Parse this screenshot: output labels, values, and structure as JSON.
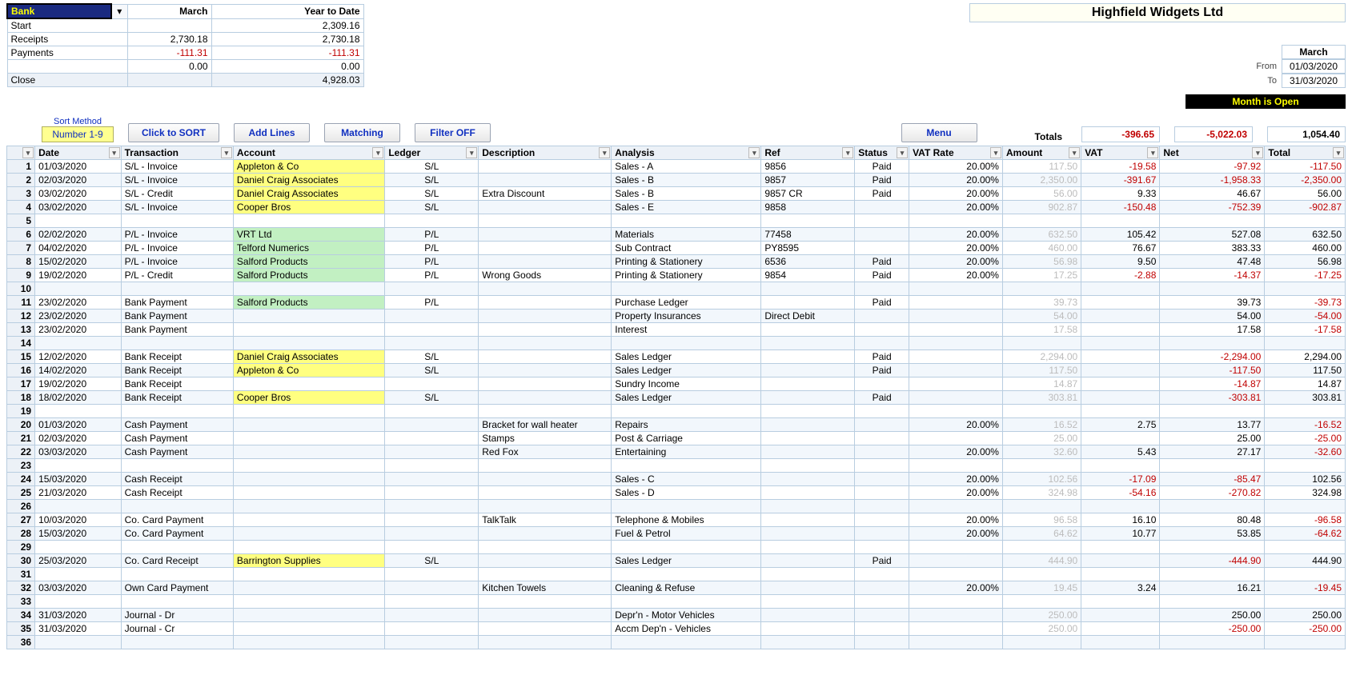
{
  "summary": {
    "bank_label": "Bank",
    "month_hdr": "March",
    "ytd_hdr": "Year to Date",
    "rows": {
      "start": {
        "label": "Start",
        "month": "",
        "ytd": "2,309.16"
      },
      "receipts": {
        "label": "Receipts",
        "month": "2,730.18",
        "ytd": "2,730.18"
      },
      "payments": {
        "label": "Payments",
        "month": "-111.31",
        "ytd": "-111.31"
      },
      "zero": {
        "label": "",
        "month": "0.00",
        "ytd": "0.00"
      },
      "close": {
        "label": "Close",
        "month": "",
        "ytd": "4,928.03"
      }
    }
  },
  "company": "Highfield Widgets Ltd",
  "period": {
    "month": "March",
    "from_label": "From",
    "from": "01/03/2020",
    "to_label": "To",
    "to": "31/03/2020",
    "status": "Month  is  Open"
  },
  "sort": {
    "title": "Sort Method",
    "badge": "Number  1-9"
  },
  "buttons": {
    "sort": "Click to SORT",
    "add_lines": "Add Lines",
    "matching": "Matching",
    "filter_off": "Filter OFF",
    "menu": "Menu"
  },
  "totals": {
    "label": "Totals",
    "amount": "-396.65",
    "vat": "-5,022.03",
    "net": "1,054.40"
  },
  "columns": {
    "date": "Date",
    "transaction": "Transaction",
    "account": "Account",
    "ledger": "Ledger",
    "description": "Description",
    "analysis": "Analysis",
    "ref": "Ref",
    "status": "Status",
    "vat_rate": "VAT Rate",
    "amount": "Amount",
    "vat": "VAT",
    "net": "Net",
    "total": "Total"
  },
  "rows": [
    {
      "n": "1",
      "date": "01/03/2020",
      "trans": "S/L - Invoice",
      "account": "Appleton & Co",
      "acct_cls": "acct-yellow",
      "ledger": "S/L",
      "desc": "",
      "analysis": "Sales - A",
      "ref": "9856",
      "status": "Paid",
      "vatrate": "20.00%",
      "amount": "117.50",
      "vat": "-19.58",
      "net": "-97.92",
      "total": "-117.50",
      "vat_red": true,
      "net_red": true,
      "total_red": true
    },
    {
      "n": "2",
      "date": "02/03/2020",
      "trans": "S/L - Invoice",
      "account": "Daniel Craig Associates",
      "acct_cls": "acct-yellow",
      "ledger": "S/L",
      "desc": "",
      "analysis": "Sales - B",
      "ref": "9857",
      "status": "Paid",
      "vatrate": "20.00%",
      "amount": "2,350.00",
      "vat": "-391.67",
      "net": "-1,958.33",
      "total": "-2,350.00",
      "vat_red": true,
      "net_red": true,
      "total_red": true
    },
    {
      "n": "3",
      "date": "03/02/2020",
      "trans": "S/L - Credit",
      "account": "Daniel Craig Associates",
      "acct_cls": "acct-yellow",
      "ledger": "S/L",
      "desc": "Extra Discount",
      "analysis": "Sales - B",
      "ref": "9857 CR",
      "status": "Paid",
      "vatrate": "20.00%",
      "amount": "56.00",
      "vat": "9.33",
      "net": "46.67",
      "total": "56.00"
    },
    {
      "n": "4",
      "date": "03/02/2020",
      "trans": "S/L - Invoice",
      "account": "Cooper Bros",
      "acct_cls": "acct-yellow",
      "ledger": "S/L",
      "desc": "",
      "analysis": "Sales - E",
      "ref": "9858",
      "status": "",
      "vatrate": "20.00%",
      "amount": "902.87",
      "vat": "-150.48",
      "net": "-752.39",
      "total": "-902.87",
      "vat_red": true,
      "net_red": true,
      "total_red": true
    },
    {
      "n": "5"
    },
    {
      "n": "6",
      "date": "02/02/2020",
      "trans": "P/L - Invoice",
      "account": "VRT Ltd",
      "acct_cls": "acct-green",
      "ledger": "P/L",
      "desc": "",
      "analysis": "Materials",
      "ref": "77458",
      "status": "",
      "vatrate": "20.00%",
      "amount": "632.50",
      "vat": "105.42",
      "net": "527.08",
      "total": "632.50"
    },
    {
      "n": "7",
      "date": "04/02/2020",
      "trans": "P/L - Invoice",
      "account": "Telford Numerics",
      "acct_cls": "acct-green",
      "ledger": "P/L",
      "desc": "",
      "analysis": "Sub Contract",
      "ref": "PY8595",
      "status": "",
      "vatrate": "20.00%",
      "amount": "460.00",
      "vat": "76.67",
      "net": "383.33",
      "total": "460.00"
    },
    {
      "n": "8",
      "date": "15/02/2020",
      "trans": "P/L - Invoice",
      "account": "Salford Products",
      "acct_cls": "acct-green",
      "ledger": "P/L",
      "desc": "",
      "analysis": "Printing & Stationery",
      "ref": "6536",
      "status": "Paid",
      "vatrate": "20.00%",
      "amount": "56.98",
      "vat": "9.50",
      "net": "47.48",
      "total": "56.98"
    },
    {
      "n": "9",
      "date": "19/02/2020",
      "trans": "P/L - Credit",
      "account": "Salford Products",
      "acct_cls": "acct-green",
      "ledger": "P/L",
      "desc": "Wrong Goods",
      "analysis": "Printing & Stationery",
      "ref": "9854",
      "status": "Paid",
      "vatrate": "20.00%",
      "amount": "17.25",
      "vat": "-2.88",
      "net": "-14.37",
      "total": "-17.25",
      "vat_red": true,
      "net_red": true,
      "total_red": true
    },
    {
      "n": "10"
    },
    {
      "n": "11",
      "date": "23/02/2020",
      "trans": "Bank Payment",
      "account": "Salford Products",
      "acct_cls": "acct-green",
      "ledger": "P/L",
      "desc": "",
      "analysis": "Purchase Ledger",
      "ref": "",
      "status": "Paid",
      "vatrate": "",
      "amount": "39.73",
      "vat": "",
      "net": "39.73",
      "total": "-39.73",
      "total_red": true
    },
    {
      "n": "12",
      "date": "23/02/2020",
      "trans": "Bank Payment",
      "account": "",
      "ledger": "",
      "desc": "",
      "analysis": "Property Insurances",
      "ref": "Direct Debit",
      "status": "",
      "vatrate": "",
      "amount": "54.00",
      "vat": "",
      "net": "54.00",
      "total": "-54.00",
      "total_red": true
    },
    {
      "n": "13",
      "date": "23/02/2020",
      "trans": "Bank Payment",
      "account": "",
      "ledger": "",
      "desc": "",
      "analysis": "Interest",
      "ref": "",
      "status": "",
      "vatrate": "",
      "amount": "17.58",
      "vat": "",
      "net": "17.58",
      "total": "-17.58",
      "total_red": true
    },
    {
      "n": "14"
    },
    {
      "n": "15",
      "date": "12/02/2020",
      "trans": "Bank Receipt",
      "account": "Daniel Craig Associates",
      "acct_cls": "acct-yellow",
      "ledger": "S/L",
      "desc": "",
      "analysis": "Sales Ledger",
      "ref": "",
      "status": "Paid",
      "vatrate": "",
      "amount": "2,294.00",
      "vat": "",
      "net": "-2,294.00",
      "total": "2,294.00",
      "net_red": true
    },
    {
      "n": "16",
      "date": "14/02/2020",
      "trans": "Bank Receipt",
      "account": "Appleton & Co",
      "acct_cls": "acct-yellow",
      "ledger": "S/L",
      "desc": "",
      "analysis": "Sales Ledger",
      "ref": "",
      "status": "Paid",
      "vatrate": "",
      "amount": "117.50",
      "vat": "",
      "net": "-117.50",
      "total": "117.50",
      "net_red": true
    },
    {
      "n": "17",
      "date": "19/02/2020",
      "trans": "Bank Receipt",
      "account": "",
      "ledger": "",
      "desc": "",
      "analysis": "Sundry Income",
      "ref": "",
      "status": "",
      "vatrate": "",
      "amount": "14.87",
      "vat": "",
      "net": "-14.87",
      "total": "14.87",
      "net_red": true
    },
    {
      "n": "18",
      "date": "18/02/2020",
      "trans": "Bank Receipt",
      "account": "Cooper Bros",
      "acct_cls": "acct-yellow",
      "ledger": "S/L",
      "desc": "",
      "analysis": "Sales Ledger",
      "ref": "",
      "status": "Paid",
      "vatrate": "",
      "amount": "303.81",
      "vat": "",
      "net": "-303.81",
      "total": "303.81",
      "net_red": true
    },
    {
      "n": "19"
    },
    {
      "n": "20",
      "date": "01/03/2020",
      "trans": "Cash Payment",
      "account": "",
      "ledger": "",
      "desc": "Bracket for wall heater",
      "analysis": "Repairs",
      "ref": "",
      "status": "",
      "vatrate": "20.00%",
      "amount": "16.52",
      "vat": "2.75",
      "net": "13.77",
      "total": "-16.52",
      "total_red": true
    },
    {
      "n": "21",
      "date": "02/03/2020",
      "trans": "Cash Payment",
      "account": "",
      "ledger": "",
      "desc": "Stamps",
      "analysis": "Post & Carriage",
      "ref": "",
      "status": "",
      "vatrate": "",
      "amount": "25.00",
      "vat": "",
      "net": "25.00",
      "total": "-25.00",
      "total_red": true
    },
    {
      "n": "22",
      "date": "03/03/2020",
      "trans": "Cash Payment",
      "account": "",
      "ledger": "",
      "desc": "Red Fox",
      "analysis": "Entertaining",
      "ref": "",
      "status": "",
      "vatrate": "20.00%",
      "amount": "32.60",
      "vat": "5.43",
      "net": "27.17",
      "total": "-32.60",
      "total_red": true
    },
    {
      "n": "23"
    },
    {
      "n": "24",
      "date": "15/03/2020",
      "trans": "Cash Receipt",
      "account": "",
      "ledger": "",
      "desc": "",
      "analysis": "Sales - C",
      "ref": "",
      "status": "",
      "vatrate": "20.00%",
      "amount": "102.56",
      "vat": "-17.09",
      "net": "-85.47",
      "total": "102.56",
      "vat_red": true,
      "net_red": true
    },
    {
      "n": "25",
      "date": "21/03/2020",
      "trans": "Cash Receipt",
      "account": "",
      "ledger": "",
      "desc": "",
      "analysis": "Sales - D",
      "ref": "",
      "status": "",
      "vatrate": "20.00%",
      "amount": "324.98",
      "vat": "-54.16",
      "net": "-270.82",
      "total": "324.98",
      "vat_red": true,
      "net_red": true
    },
    {
      "n": "26"
    },
    {
      "n": "27",
      "date": "10/03/2020",
      "trans": "Co. Card Payment",
      "account": "",
      "ledger": "",
      "desc": "TalkTalk",
      "analysis": "Telephone & Mobiles",
      "ref": "",
      "status": "",
      "vatrate": "20.00%",
      "amount": "96.58",
      "vat": "16.10",
      "net": "80.48",
      "total": "-96.58",
      "total_red": true
    },
    {
      "n": "28",
      "date": "15/03/2020",
      "trans": "Co. Card Payment",
      "account": "",
      "ledger": "",
      "desc": "",
      "analysis": "Fuel & Petrol",
      "ref": "",
      "status": "",
      "vatrate": "20.00%",
      "amount": "64.62",
      "vat": "10.77",
      "net": "53.85",
      "total": "-64.62",
      "total_red": true
    },
    {
      "n": "29"
    },
    {
      "n": "30",
      "date": "25/03/2020",
      "trans": "Co. Card Receipt",
      "account": "Barrington Supplies",
      "acct_cls": "acct-yellow",
      "ledger": "S/L",
      "desc": "",
      "analysis": "Sales Ledger",
      "ref": "",
      "status": "Paid",
      "vatrate": "",
      "amount": "444.90",
      "vat": "",
      "net": "-444.90",
      "total": "444.90",
      "net_red": true
    },
    {
      "n": "31"
    },
    {
      "n": "32",
      "date": "03/03/2020",
      "trans": "Own Card Payment",
      "account": "",
      "ledger": "",
      "desc": "Kitchen Towels",
      "analysis": "Cleaning & Refuse",
      "ref": "",
      "status": "",
      "vatrate": "20.00%",
      "amount": "19.45",
      "vat": "3.24",
      "net": "16.21",
      "total": "-19.45",
      "total_red": true
    },
    {
      "n": "33"
    },
    {
      "n": "34",
      "date": "31/03/2020",
      "trans": "Journal - Dr",
      "account": "",
      "ledger": "",
      "desc": "",
      "analysis": "Depr'n - Motor Vehicles",
      "ref": "",
      "status": "",
      "vatrate": "",
      "amount": "250.00",
      "vat": "",
      "net": "250.00",
      "total": "250.00"
    },
    {
      "n": "35",
      "date": "31/03/2020",
      "trans": "Journal - Cr",
      "account": "",
      "ledger": "",
      "desc": "",
      "analysis": "Accm Dep'n - Vehicles",
      "ref": "",
      "status": "",
      "vatrate": "",
      "amount": "250.00",
      "vat": "",
      "net": "-250.00",
      "total": "-250.00",
      "net_red": true,
      "total_red": true
    },
    {
      "n": "36"
    }
  ]
}
